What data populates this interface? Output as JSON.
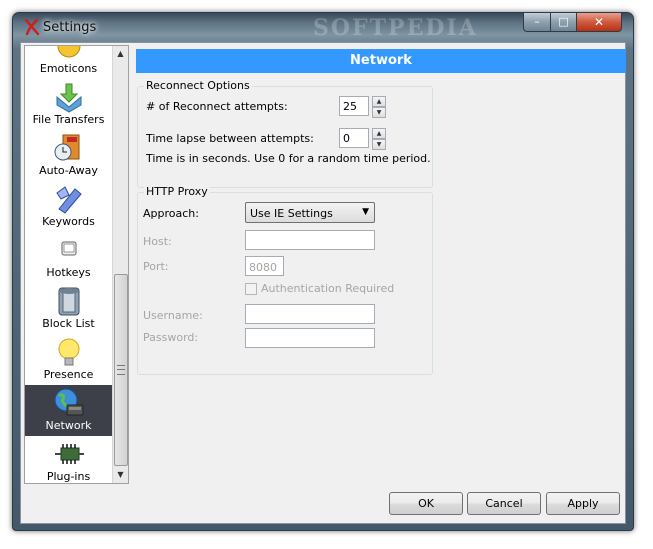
{
  "window": {
    "title": "Settings",
    "watermark": "SOFTPEDIA",
    "controls": {
      "minimize": "–",
      "maximize": "□",
      "close": "✕"
    }
  },
  "sidebar": {
    "items": [
      {
        "label": "Emoticons",
        "icon": "emoticons-icon",
        "selected": false
      },
      {
        "label": "File Transfers",
        "icon": "file-transfers-icon",
        "selected": false
      },
      {
        "label": "Auto-Away",
        "icon": "auto-away-icon",
        "selected": false
      },
      {
        "label": "Keywords",
        "icon": "keywords-icon",
        "selected": false
      },
      {
        "label": "Hotkeys",
        "icon": "hotkeys-icon",
        "selected": false
      },
      {
        "label": "Block List",
        "icon": "block-list-icon",
        "selected": false
      },
      {
        "label": "Presence",
        "icon": "presence-icon",
        "selected": false
      },
      {
        "label": "Network",
        "icon": "network-icon",
        "selected": true
      },
      {
        "label": "Plug-ins",
        "icon": "plug-ins-icon",
        "selected": false
      }
    ],
    "scroll_up": "▲",
    "scroll_down": "▼"
  },
  "page": {
    "header": "Network",
    "header_color": "#3399ff"
  },
  "reconnect": {
    "legend": "Reconnect Options",
    "attempts_label": "# of Reconnect attempts:",
    "attempts_value": "25",
    "lapse_label": "Time lapse between attempts:",
    "lapse_value": "0",
    "note": "Time is in seconds. Use 0 for a random time period."
  },
  "proxy": {
    "legend": "HTTP Proxy",
    "approach_label": "Approach:",
    "approach_value": "Use IE Settings",
    "host_label": "Host:",
    "host_value": "",
    "port_label": "Port:",
    "port_value": "8080",
    "auth_label": "Authentication Required",
    "username_label": "Username:",
    "username_value": "",
    "password_label": "Password:",
    "password_value": ""
  },
  "footer": {
    "ok": "OK",
    "cancel": "Cancel",
    "apply": "Apply"
  }
}
